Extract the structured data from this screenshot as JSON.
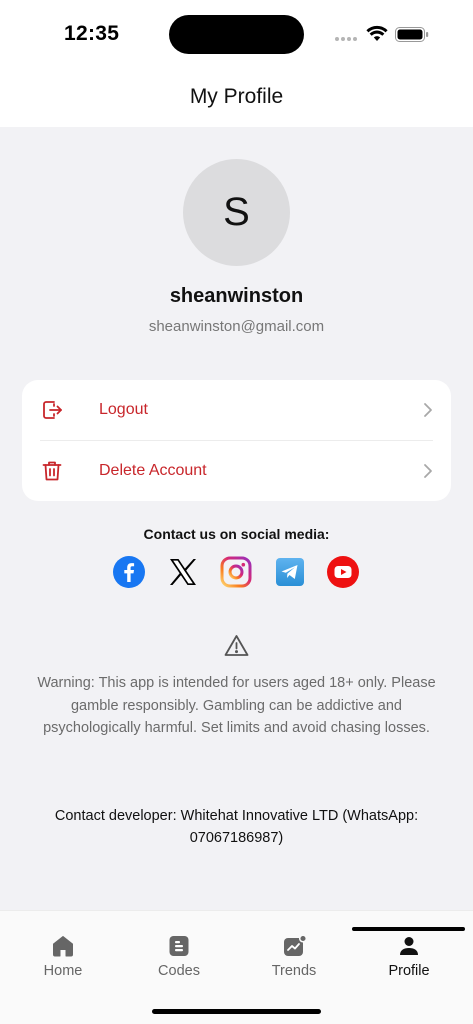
{
  "status_bar": {
    "time": "12:35"
  },
  "header": {
    "title": "My Profile"
  },
  "profile": {
    "initial": "S",
    "username": "sheanwinston",
    "email": "sheanwinston@gmail.com"
  },
  "actions": [
    {
      "label": "Logout",
      "icon": "logout-icon"
    },
    {
      "label": "Delete Account",
      "icon": "trash-icon"
    }
  ],
  "social": {
    "title": "Contact us on social media:",
    "links": [
      "facebook-icon",
      "x-icon",
      "instagram-icon",
      "telegram-icon",
      "youtube-icon"
    ]
  },
  "warning": {
    "icon": "warning-icon",
    "text": "Warning: This app is intended for users aged 18+ only. Please gamble responsibly. Gambling can be addictive and psychologically harmful. Set limits and avoid chasing losses."
  },
  "developer": {
    "text": "Contact developer: Whitehat Innovative LTD (WhatsApp: 07067186987)"
  },
  "tabs": [
    {
      "label": "Home",
      "icon": "home-icon",
      "active": false
    },
    {
      "label": "Codes",
      "icon": "codes-icon",
      "active": false
    },
    {
      "label": "Trends",
      "icon": "trends-icon",
      "active": false
    },
    {
      "label": "Profile",
      "icon": "profile-icon",
      "active": true
    }
  ],
  "colors": {
    "accent_red": "#c8262b",
    "background": "#f2f2f5",
    "card": "#ffffff"
  }
}
